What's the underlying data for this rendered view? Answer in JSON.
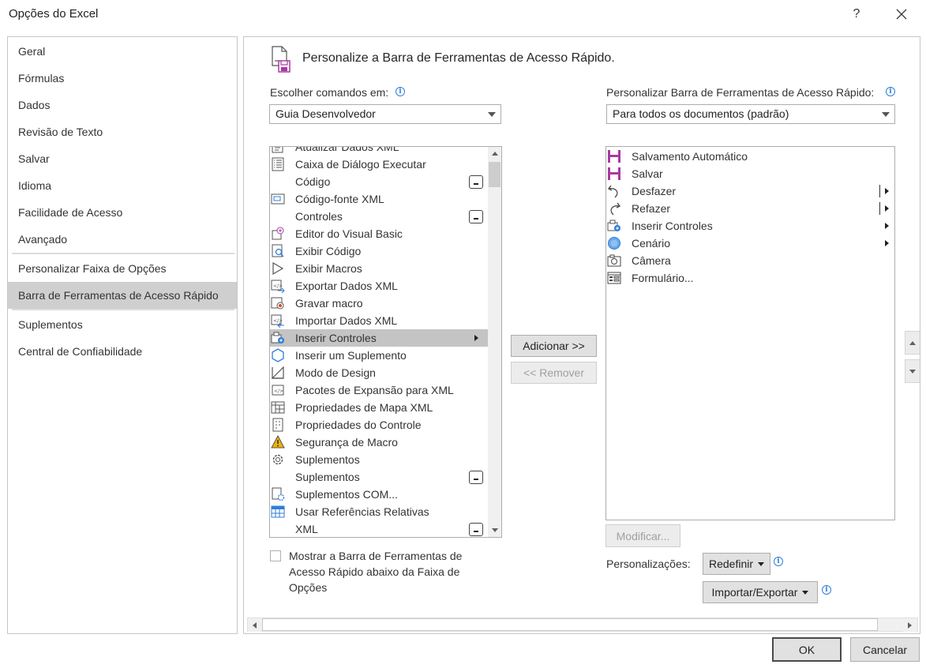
{
  "window": {
    "title": "Opções do Excel",
    "help": "?",
    "close": "✕"
  },
  "sidebar": {
    "items": [
      {
        "label": "Geral"
      },
      {
        "label": "Fórmulas"
      },
      {
        "label": "Dados"
      },
      {
        "label": "Revisão de Texto"
      },
      {
        "label": "Salvar"
      },
      {
        "label": "Idioma"
      },
      {
        "label": "Facilidade de Acesso"
      },
      {
        "label": "Avançado"
      },
      {
        "label": "Personalizar Faixa de Opções"
      },
      {
        "label": "Barra de Ferramentas de Acesso Rápido"
      },
      {
        "label": "Suplementos"
      },
      {
        "label": "Central de Confiabilidade"
      }
    ],
    "selected": "Barra de Ferramentas de Acesso Rápido"
  },
  "main": {
    "heading": "Personalize a Barra de Ferramentas de Acesso Rápido.",
    "choose_label": "Escolher comandos em:",
    "choose_value": "Guia Desenvolvedor",
    "customize_label": "Personalizar Barra de Ferramentas de Acesso Rápido:",
    "customize_value": "Para todos os documentos (padrão)",
    "commands": [
      {
        "label": "Atualizar Dados XML",
        "icon": "refresh-xml-icon"
      },
      {
        "label": "Caixa de Diálogo Executar",
        "icon": "run-dialog-icon"
      },
      {
        "label": "Código",
        "icon": "none"
      },
      {
        "label": "Código-fonte XML",
        "icon": "xml-source-icon"
      },
      {
        "label": "Controles",
        "icon": "none"
      },
      {
        "label": "Editor do Visual Basic",
        "icon": "vb-editor-icon"
      },
      {
        "label": "Exibir Código",
        "icon": "view-code-icon"
      },
      {
        "label": "Exibir Macros",
        "icon": "macros-icon"
      },
      {
        "label": "Exportar Dados XML",
        "icon": "export-xml-icon"
      },
      {
        "label": "Gravar macro",
        "icon": "record-macro-icon"
      },
      {
        "label": "Importar Dados XML",
        "icon": "import-xml-icon"
      },
      {
        "label": "Inserir Controles",
        "icon": "insert-controls-icon"
      },
      {
        "label": "Inserir um Suplemento",
        "icon": "addin-icon"
      },
      {
        "label": "Modo de Design",
        "icon": "design-mode-icon"
      },
      {
        "label": "Pacotes de Expansão para XML",
        "icon": "xml-packs-icon"
      },
      {
        "label": "Propriedades de Mapa XML",
        "icon": "map-properties-icon"
      },
      {
        "label": "Propriedades do Controle",
        "icon": "control-properties-icon"
      },
      {
        "label": "Segurança de Macro",
        "icon": "warning-icon"
      },
      {
        "label": "Suplementos",
        "icon": "gear-icon"
      },
      {
        "label": "Suplementos",
        "icon": "none"
      },
      {
        "label": "Suplementos COM...",
        "icon": "com-addins-icon"
      },
      {
        "label": "Usar Referências Relativas",
        "icon": "relative-refs-icon"
      },
      {
        "label": "XML",
        "icon": "none"
      }
    ],
    "highlighted_command": "Inserir Controles",
    "toolbar_items": [
      {
        "label": "Salvamento Automático",
        "icon": "autosave-icon"
      },
      {
        "label": "Salvar",
        "icon": "save-icon"
      },
      {
        "label": "Desfazer",
        "icon": "undo-icon"
      },
      {
        "label": "Refazer",
        "icon": "redo-icon"
      },
      {
        "label": "Inserir Controles",
        "icon": "insert-controls-icon"
      },
      {
        "label": "Cenário",
        "icon": "scenario-icon"
      },
      {
        "label": "Câmera",
        "icon": "camera-icon"
      },
      {
        "label": "Formulário...",
        "icon": "form-icon"
      }
    ],
    "add_button": "Adicionar >>",
    "remove_button": "<< Remover",
    "modify_button": "Modificar...",
    "show_below_label_line1": "Mostrar a Barra de Ferramentas de",
    "show_below_label_line2": "Acesso Rápido abaixo da Faixa de",
    "show_below_label_line3": "Opções",
    "show_below_checked": false,
    "customizations_label": "Personalizações:",
    "reset_button": "Redefinir",
    "import_export_button": "Importar/Exportar"
  },
  "footer": {
    "ok": "OK",
    "cancel": "Cancelar"
  },
  "colors": {
    "selection": "#cfcfcf",
    "highlight_row": "#c4c4c4",
    "accent_purple": "#a93aa1",
    "info_blue": "#2f7ed8"
  }
}
